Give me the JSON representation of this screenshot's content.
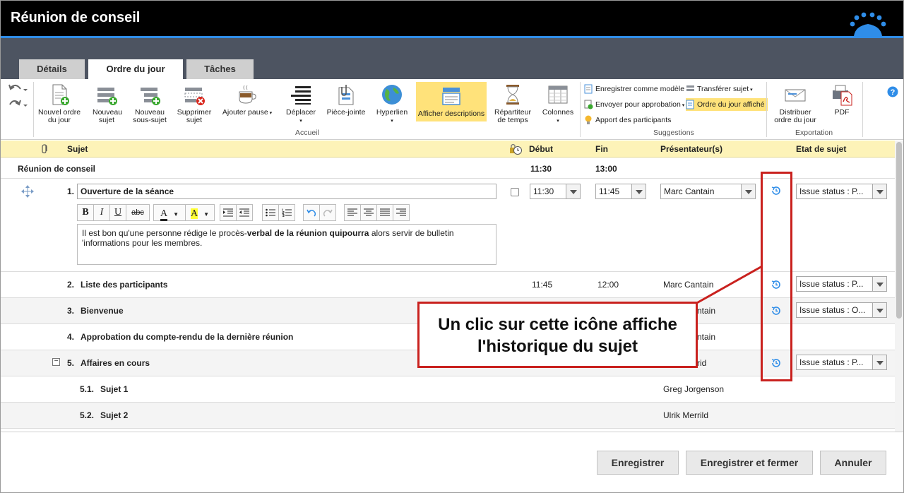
{
  "window": {
    "title": "Réunion de conseil"
  },
  "tabs": [
    {
      "label": "Détails"
    },
    {
      "label": "Ordre du jour",
      "active": true
    },
    {
      "label": "Tâches"
    }
  ],
  "ribbon": {
    "accueil": {
      "label": "Accueil",
      "buttons": [
        {
          "label": "Nouvel ordre du jour"
        },
        {
          "label": "Nouveau sujet"
        },
        {
          "label": "Nouveau sous-sujet"
        },
        {
          "label": "Supprimer sujet"
        },
        {
          "label": "Ajouter pause"
        },
        {
          "label": "Déplacer"
        },
        {
          "label": "Pièce-jointe"
        },
        {
          "label": "Hyperlien"
        },
        {
          "label": "Afficher descriptions"
        },
        {
          "label": "Répartiteur de temps"
        },
        {
          "label": "Colonnes"
        }
      ]
    },
    "suggestions": {
      "label": "Suggestions",
      "items": [
        {
          "label": "Enregistrer comme modèle"
        },
        {
          "label": "Transférer sujet"
        },
        {
          "label": "Envoyer pour approbation"
        },
        {
          "label": "Ordre du jour affiché"
        },
        {
          "label": "Apport des participants"
        }
      ]
    },
    "exportation": {
      "label": "Exportation",
      "buttons": [
        {
          "label": "Distribuer ordre du jour"
        },
        {
          "label": "PDF"
        }
      ]
    }
  },
  "columns": {
    "subject": "Sujet",
    "start": "Début",
    "end": "Fin",
    "presenter": "Présentateur(s)",
    "status": "Etat de sujet"
  },
  "meeting": {
    "name": "Réunion de conseil",
    "start": "11:30",
    "end": "13:00"
  },
  "items": [
    {
      "num": "1.",
      "title": "Ouverture de la séance",
      "start": "11:30",
      "end": "11:45",
      "presenter": "Marc Cantain",
      "status": "Issue status : P...",
      "description_plain1": "Il est bon qu'une personne rédige le procès-",
      "description_bold": "verbal de la réunion quipourra",
      "description_plain2": " alors servir de bulletin",
      "description_line2": "'informations pour les membres."
    },
    {
      "num": "2.",
      "title": "Liste des participants",
      "start": "11:45",
      "end": "12:00",
      "presenter": "Marc Cantain",
      "status": "Issue status : P..."
    },
    {
      "num": "3.",
      "title": "Bienvenue",
      "presenter": "ntain",
      "status": "Issue status : O..."
    },
    {
      "num": "4.",
      "title": "Approbation du compte-rendu de la dernière réunion",
      "presenter": "ntain"
    },
    {
      "num": "5.",
      "title": "Affaires en cours",
      "presenter": "rid",
      "status": "Issue status : P..."
    },
    {
      "num": "5.1.",
      "title": "Sujet 1",
      "presenter": "Greg Jorgenson"
    },
    {
      "num": "5.2.",
      "title": "Sujet 2",
      "presenter": "Ulrik Merrild"
    }
  ],
  "callout": {
    "line1": "Un clic sur cette icône affiche",
    "line2": "l'historique du sujet"
  },
  "footer": {
    "save": "Enregistrer",
    "save_close": "Enregistrer et fermer",
    "cancel": "Annuler"
  },
  "colors": {
    "accent": "#2f8de8",
    "highlight": "#ffe27a",
    "callout": "#c9211e",
    "header_bg": "#fdf3b8"
  }
}
